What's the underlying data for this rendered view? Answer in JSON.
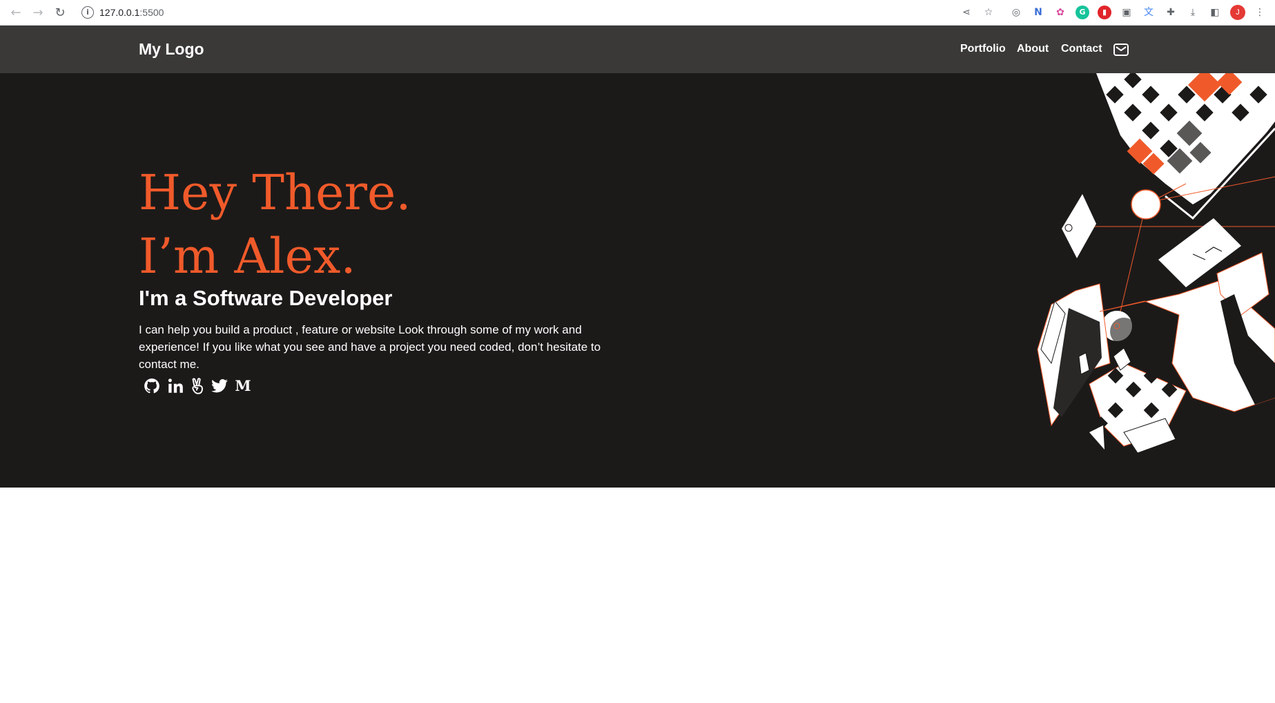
{
  "browser": {
    "url_host": "127.0.0.1",
    "url_port": ":5500",
    "avatar_letter": "J"
  },
  "header": {
    "logo": "My Logo",
    "nav": [
      {
        "label": "Portfolio"
      },
      {
        "label": "About"
      },
      {
        "label": "Contact"
      }
    ],
    "mail_icon": "envelope-icon"
  },
  "hero": {
    "greeting_line1": "Hey There.",
    "greeting_line2": "I’m Alex.",
    "subtitle": "I'm a Software Developer",
    "description": "I can help you build a product , feature or website Look through some of my work and experience! If you like what you see and have a project you need coded, don’t hesitate to contact me.",
    "socials": [
      {
        "name": "github-icon"
      },
      {
        "name": "linkedin-icon"
      },
      {
        "name": "angellist-icon"
      },
      {
        "name": "twitter-icon"
      },
      {
        "name": "medium-icon",
        "glyph": "M"
      }
    ]
  },
  "colors": {
    "accent": "#f05a2a",
    "header_bg": "#3a3938",
    "hero_bg": "#1c1a19",
    "text": "#ffffff"
  }
}
